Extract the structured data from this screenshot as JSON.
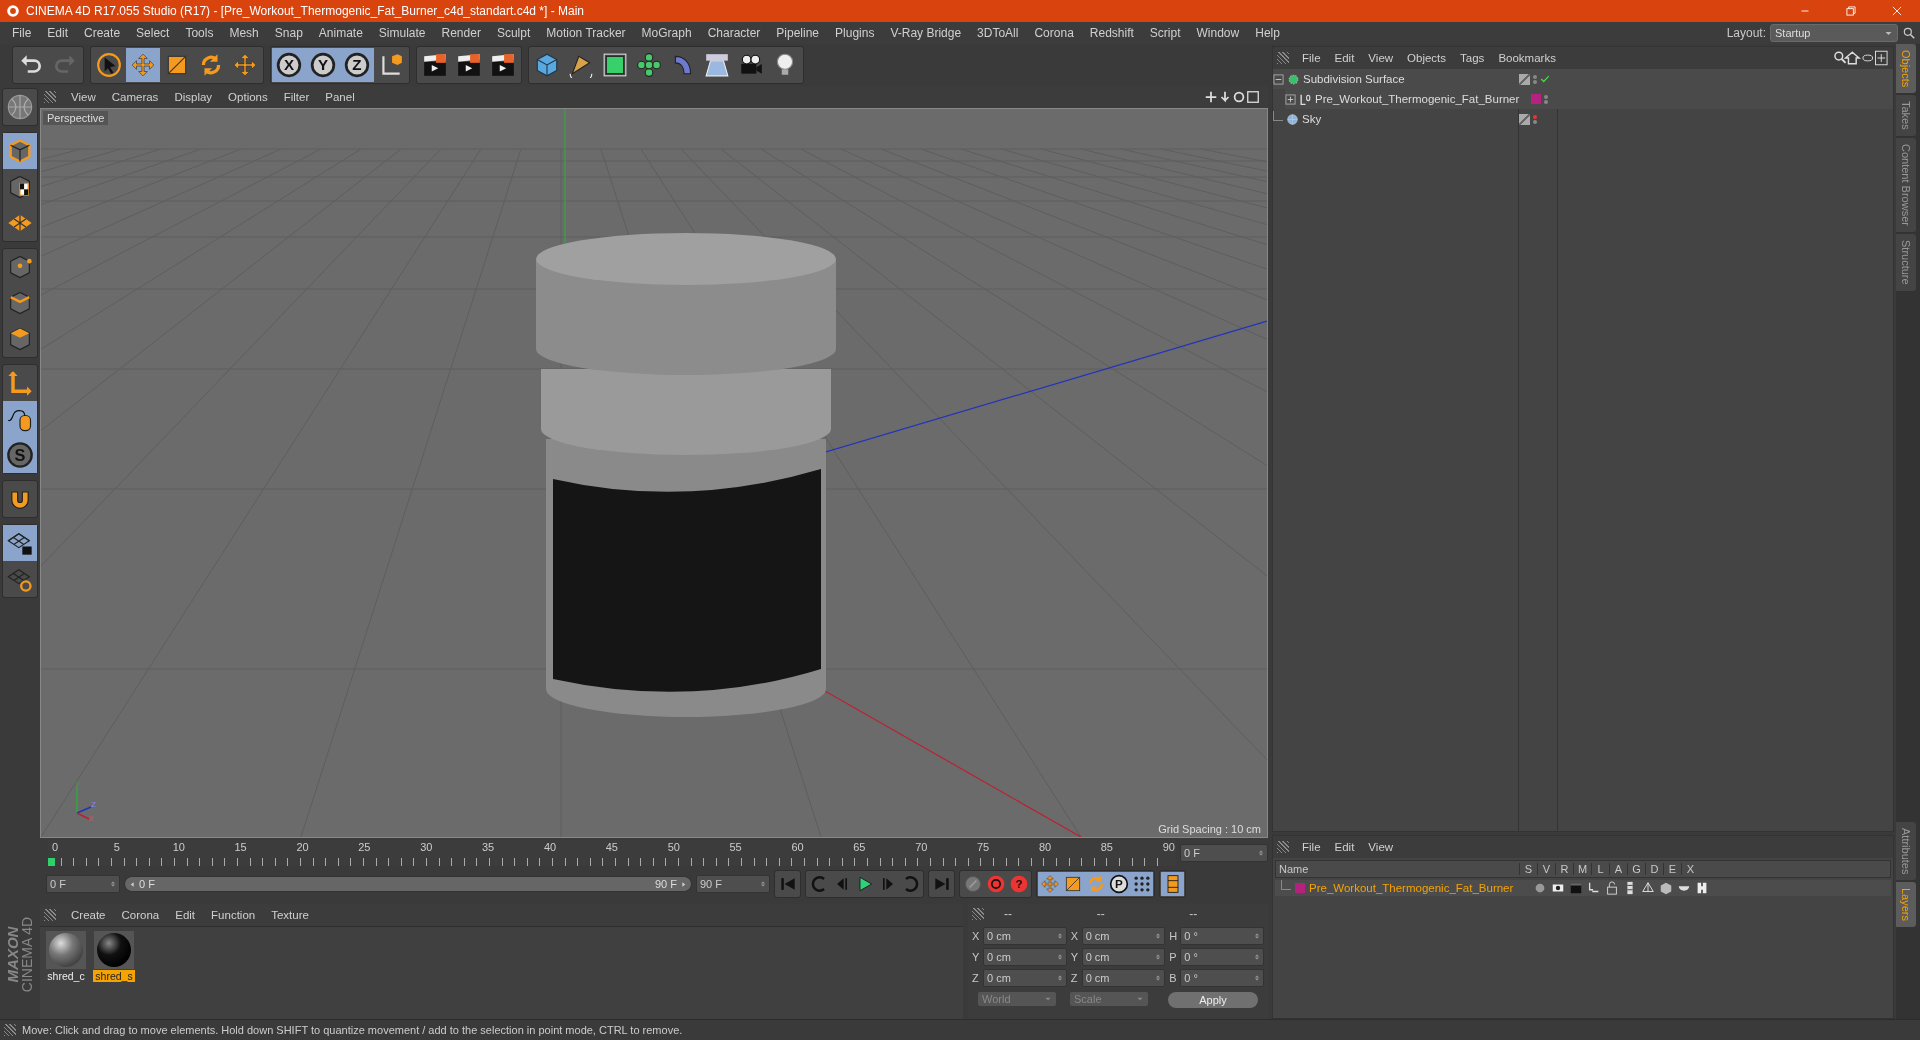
{
  "window": {
    "title": "CINEMA 4D R17.055 Studio (R17) - [Pre_Workout_Thermogenic_Fat_Burner_c4d_standart.c4d *] - Main"
  },
  "menu": [
    "File",
    "Edit",
    "Create",
    "Select",
    "Tools",
    "Mesh",
    "Snap",
    "Animate",
    "Simulate",
    "Render",
    "Sculpt",
    "Motion Tracker",
    "MoGraph",
    "Character",
    "Pipeline",
    "Plugins",
    "V-Ray Bridge",
    "3DToAll",
    "Corona",
    "Redshift",
    "Script",
    "Window",
    "Help"
  ],
  "layout": {
    "label": "Layout:",
    "value": "Startup"
  },
  "toolbar": [
    [
      {
        "kind": "undo",
        "selected": false
      },
      {
        "kind": "redo",
        "selected": false
      }
    ],
    [
      {
        "kind": "select",
        "selected": false
      },
      {
        "kind": "move",
        "selected": true
      },
      {
        "kind": "scale",
        "selected": false
      },
      {
        "kind": "rotate",
        "selected": false
      },
      {
        "kind": "move",
        "selected": false
      }
    ],
    [
      {
        "kind": "axis-letter",
        "label": "X",
        "selected": true
      },
      {
        "kind": "axis-letter",
        "label": "Y",
        "selected": true
      },
      {
        "kind": "axis-letter",
        "label": "Z",
        "selected": true
      },
      {
        "kind": "coord",
        "selected": false
      }
    ],
    [
      {
        "kind": "clapper",
        "selected": false
      },
      {
        "kind": "clapper",
        "selected": false
      },
      {
        "kind": "clapper",
        "selected": false
      }
    ],
    [
      {
        "kind": "cube",
        "selected": false
      },
      {
        "kind": "pen",
        "selected": false
      },
      {
        "kind": "subdiv",
        "selected": false
      },
      {
        "kind": "cloner",
        "selected": false
      },
      {
        "kind": "deformer",
        "selected": false
      },
      {
        "kind": "floor",
        "selected": false
      },
      {
        "kind": "camera",
        "selected": false
      },
      {
        "kind": "light",
        "selected": false
      }
    ]
  ],
  "left_tools": [
    [
      {
        "kind": "globe",
        "selected": false
      }
    ],
    [
      {
        "kind": "cube-mode",
        "selected": true
      },
      {
        "kind": "texture",
        "selected": false
      },
      {
        "kind": "workplane",
        "selected": false
      }
    ],
    [
      {
        "kind": "points",
        "selected": false
      },
      {
        "kind": "edges",
        "selected": false
      },
      {
        "kind": "polygons",
        "selected": false
      }
    ],
    [
      {
        "kind": "axis",
        "selected": false
      },
      {
        "kind": "tweak",
        "selected": true
      },
      {
        "kind": "solo",
        "label": "S",
        "selected": true
      }
    ],
    [
      {
        "kind": "magnet",
        "selected": false
      }
    ],
    [
      {
        "kind": "lock-grid",
        "selected": true
      },
      {
        "kind": "grid-sync",
        "selected": false
      }
    ]
  ],
  "logo": {
    "brand": "MAXON",
    "product": "CINEMA 4D"
  },
  "viewport": {
    "menu": [
      "View",
      "Cameras",
      "Display",
      "Options",
      "Filter",
      "Panel"
    ],
    "camera": "Perspective",
    "grid_spacing": "Grid Spacing : 10 cm",
    "gizmo_labels": [
      "Y",
      "Z",
      "X"
    ]
  },
  "timeline": {
    "ticks": [
      "0",
      "5",
      "10",
      "15",
      "20",
      "25",
      "30",
      "35",
      "40",
      "45",
      "50",
      "55",
      "60",
      "65",
      "70",
      "75",
      "80",
      "85",
      "90"
    ],
    "level": 0,
    "current": "0 F",
    "start": "0 F",
    "range": {
      "start": "0 F",
      "end": "90 F",
      "level": 1
    },
    "end": "90 F",
    "controls": [
      [
        {
          "kind": "go-start",
          "selected": false
        }
      ],
      [
        {
          "kind": "loop-back",
          "selected": false
        },
        {
          "kind": "prev-frame",
          "selected": false
        },
        {
          "kind": "play",
          "selected": false
        },
        {
          "kind": "next-frame",
          "selected": false
        },
        {
          "kind": "loop",
          "selected": false
        }
      ],
      [
        {
          "kind": "go-end",
          "selected": false
        }
      ],
      [
        {
          "kind": "key-off",
          "selected": false
        },
        {
          "kind": "record",
          "selected": false
        },
        {
          "kind": "help",
          "label": "?",
          "selected": false
        }
      ],
      [
        {
          "kind": "move",
          "selected": true
        },
        {
          "kind": "scale",
          "selected": true
        },
        {
          "kind": "rotate",
          "selected": true
        },
        {
          "kind": "param",
          "label": "P",
          "selected": true
        },
        {
          "kind": "dots",
          "selected": true
        }
      ],
      [
        {
          "kind": "film",
          "selected": true
        }
      ]
    ]
  },
  "materials": {
    "menu": [
      "Create",
      "Corona",
      "Edit",
      "Function",
      "Texture"
    ],
    "items": [
      {
        "name": "shred_c",
        "kind": "grey",
        "selected": false
      },
      {
        "name": "shred_s",
        "kind": "black",
        "selected": true
      }
    ]
  },
  "coordinates": {
    "headers": [
      "--",
      "--",
      "--"
    ],
    "rows": [
      {
        "pos_axis": "X",
        "pos": "0 cm",
        "size_axis": "X",
        "size": "0 cm",
        "rot_axis": "H",
        "rot": "0 °"
      },
      {
        "pos_axis": "Y",
        "pos": "0 cm",
        "size_axis": "Y",
        "size": "0 cm",
        "rot_axis": "P",
        "rot": "0 °"
      },
      {
        "pos_axis": "Z",
        "pos": "0 cm",
        "size_axis": "Z",
        "size": "0 cm",
        "rot_axis": "B",
        "rot": "0 °"
      }
    ],
    "mode": "World",
    "measure": "Scale",
    "apply": "Apply"
  },
  "objects": {
    "menu": [
      "File",
      "Edit",
      "View",
      "Objects",
      "Tags",
      "Bookmarks"
    ],
    "tree": [
      {
        "name": "Subdivision Surface",
        "kind": "generator",
        "expanded": true,
        "visible": true,
        "children": [
          {
            "name": "Pre_Workout_Thermogenic_Fat_Burner",
            "kind": "null",
            "expanded": false,
            "visible": true,
            "color": "#b5217e"
          }
        ]
      },
      {
        "name": "Sky",
        "kind": "sky",
        "visible": false
      }
    ]
  },
  "layers": {
    "menu": [
      "File",
      "Edit",
      "View"
    ],
    "columns": [
      "Name",
      "S",
      "V",
      "R",
      "M",
      "L",
      "A",
      "G",
      "D",
      "E",
      "X"
    ],
    "rows": [
      {
        "name": "Pre_Workout_Thermogenic_Fat_Burner",
        "color": "#b5217e"
      }
    ]
  },
  "side_tabs_top": [
    {
      "label": "Objects",
      "selected": true
    },
    {
      "label": "Takes",
      "selected": false
    },
    {
      "label": "Content Browser",
      "selected": false
    },
    {
      "label": "Structure",
      "selected": false
    }
  ],
  "side_tabs_bottom": [
    {
      "label": "Attributes",
      "selected": false
    },
    {
      "label": "Layers",
      "selected": true
    }
  ],
  "status": "Move: Click and drag to move elements. Hold down SHIFT to quantize movement / add to the selection in point mode, CTRL to remove."
}
